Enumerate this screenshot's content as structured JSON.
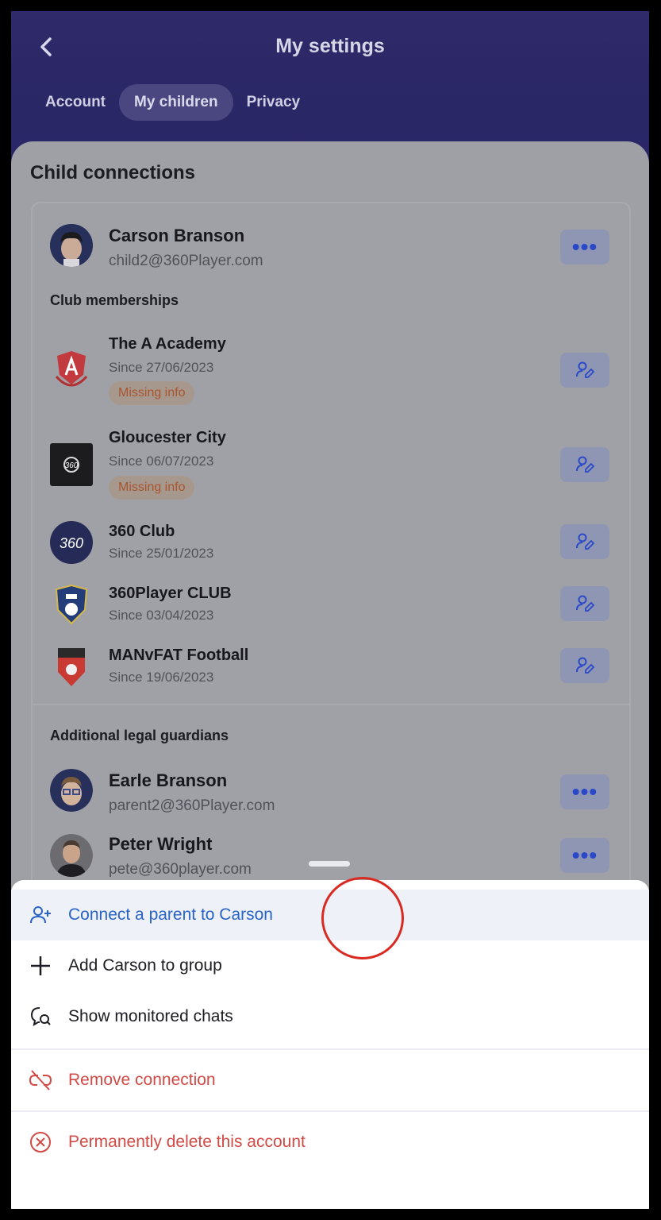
{
  "header": {
    "title": "My settings",
    "back_icon": "chevron-left-icon",
    "tabs": [
      {
        "label": "Account",
        "active": false
      },
      {
        "label": "My children",
        "active": true
      },
      {
        "label": "Privacy",
        "active": false
      }
    ]
  },
  "section": {
    "title": "Child connections"
  },
  "child": {
    "name": "Carson Branson",
    "email": "child2@360Player.com"
  },
  "memberships": {
    "label": "Club memberships",
    "clubs": [
      {
        "name": "The A Academy",
        "since": "Since 27/06/2023",
        "badge": "Missing info"
      },
      {
        "name": "Gloucester City",
        "since": "Since 06/07/2023",
        "badge": "Missing info"
      },
      {
        "name": "360 Club",
        "since": "Since 25/01/2023"
      },
      {
        "name": "360Player CLUB",
        "since": "Since 03/04/2023"
      },
      {
        "name": "MANvFAT Football",
        "since": "Since 19/06/2023"
      }
    ]
  },
  "guardians": {
    "label": "Additional legal guardians",
    "people": [
      {
        "name": "Earle Branson",
        "email": "parent2@360Player.com"
      },
      {
        "name": "Peter Wright",
        "email": "pete@360player.com"
      }
    ]
  },
  "sheet": {
    "items": [
      {
        "label": "Connect a parent to Carson",
        "icon": "user-plus-icon",
        "color": "#2a63c7"
      },
      {
        "label": "Add Carson to group",
        "icon": "plus-icon",
        "color": "#1c1c22"
      },
      {
        "label": "Show monitored chats",
        "icon": "chat-monitor-icon",
        "color": "#1c1c22"
      },
      {
        "label": "Remove connection",
        "icon": "unlink-icon",
        "color": "#d24a45"
      },
      {
        "label": "Permanently delete this account",
        "icon": "circle-x-icon",
        "color": "#d24a45"
      }
    ]
  },
  "colors": {
    "header": "#2f2a6a",
    "accent": "#2a49c9",
    "danger": "#d24a45",
    "annotation": "#d92b22"
  }
}
